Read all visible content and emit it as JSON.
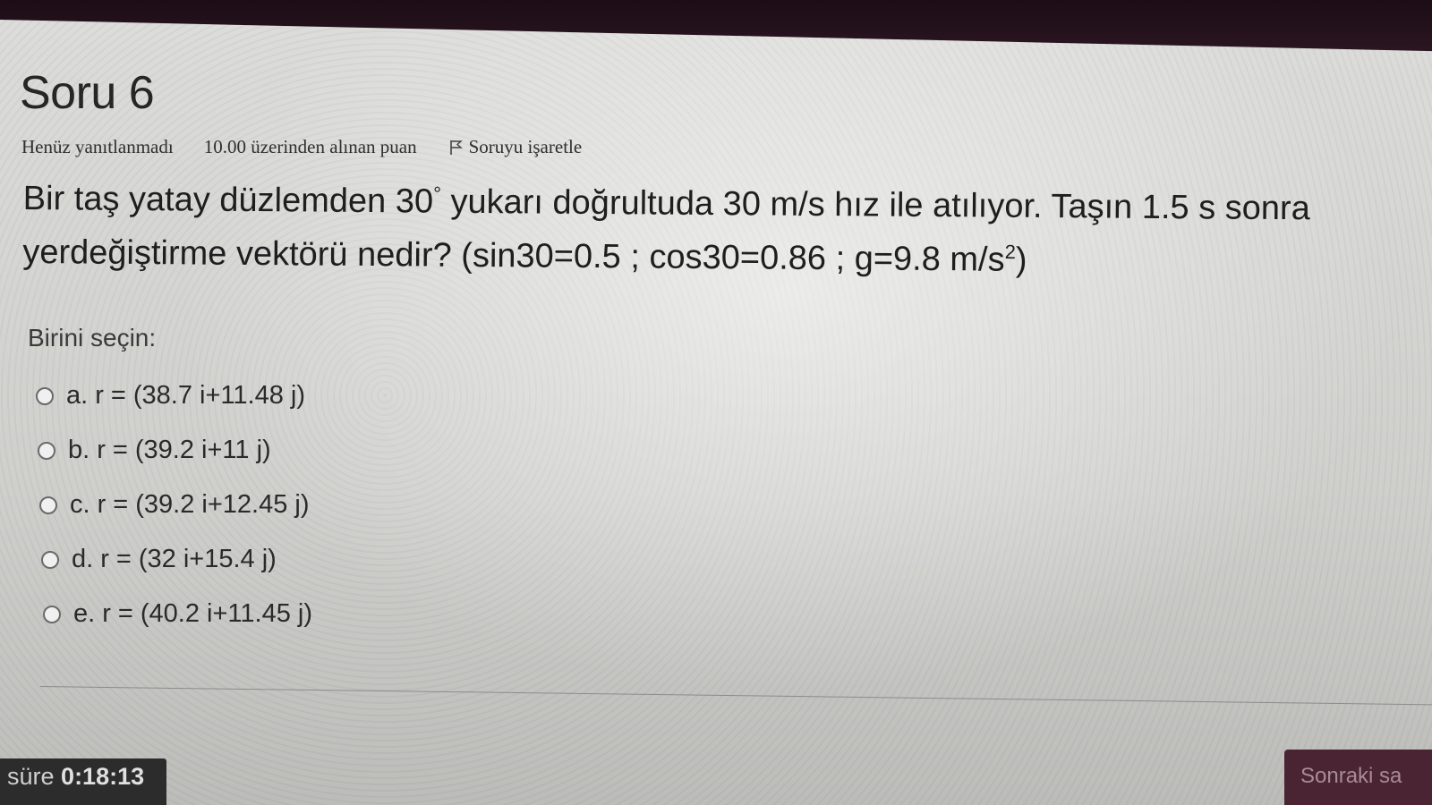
{
  "question": {
    "title": "Soru 6",
    "state": "Henüz yanıtlanmadı",
    "grade": "10.00 üzerinden alınan puan",
    "flag_label": "Soruyu işaretle",
    "text_part1": "Bir taş yatay düzlemden 30",
    "degree_sign": "°",
    "text_part2": " yukarı doğrultuda 30 m/s hız ile atılıyor. Taşın 1.5 s sonra yerdeğiştirme vektörü nedir? (sin30=0.5 ; cos30=0.86 ;  g=9.8 m/s",
    "exponent": "2",
    "text_part3": ")"
  },
  "answer": {
    "prompt": "Birini seçin:",
    "options": [
      {
        "letter": "a.",
        "text": "r = (38.7 i+11.48 j)"
      },
      {
        "letter": "b.",
        "text": "r = (39.2 i+11 j)"
      },
      {
        "letter": "c.",
        "text": "r = (39.2 i+12.45 j)"
      },
      {
        "letter": "d.",
        "text": "r = (32 i+15.4 j)"
      },
      {
        "letter": "e.",
        "text": "r = (40.2 i+11.45 j)"
      }
    ]
  },
  "footer": {
    "timer_label": "süre",
    "timer_value": "0:18:13",
    "next_label": "Sonraki sa"
  },
  "icons": {
    "flag": "flag-icon",
    "radio": "radio-unchecked-icon"
  },
  "colors": {
    "accent": "#4b2434",
    "timer_bg": "#2c2c2c"
  }
}
